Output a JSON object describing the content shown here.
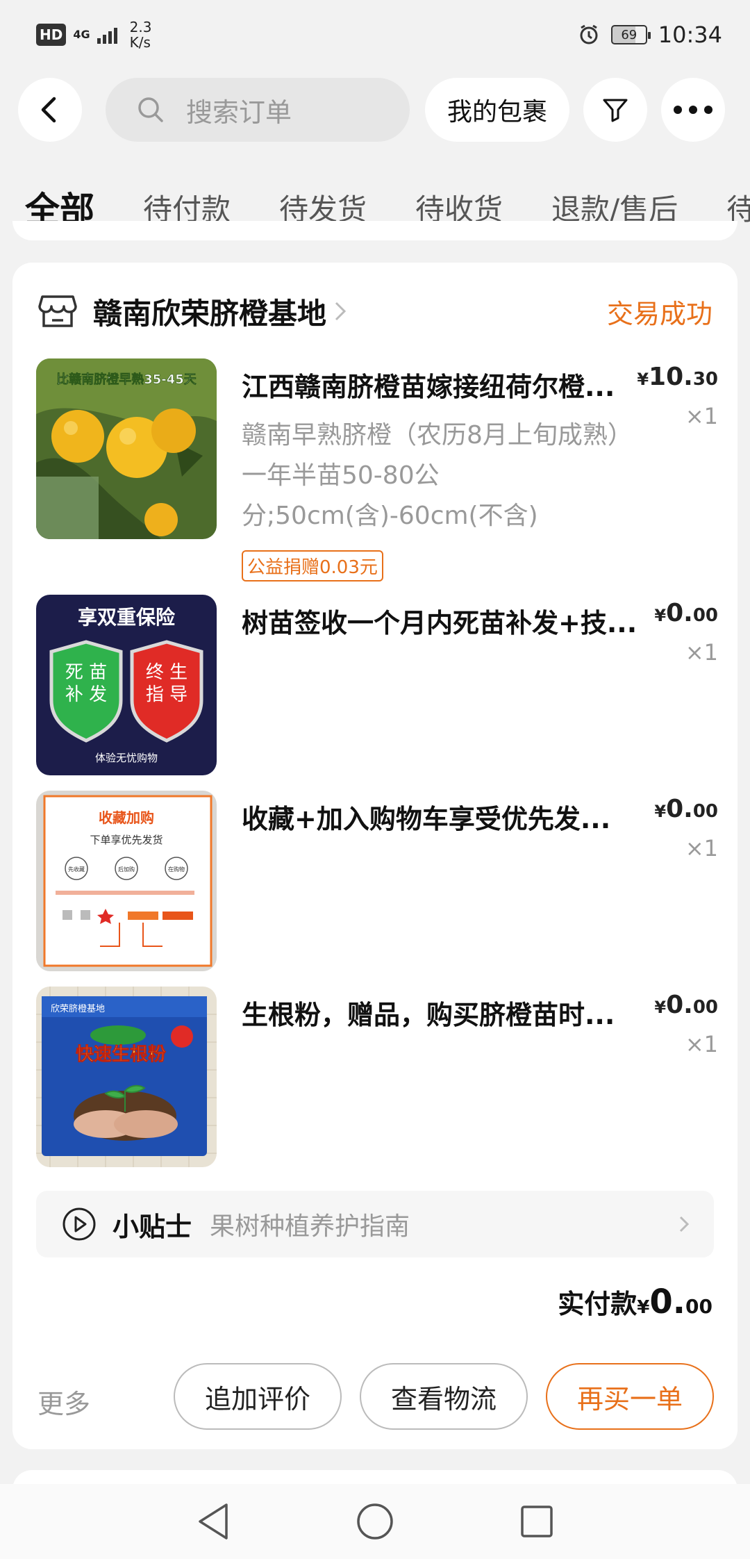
{
  "status_bar": {
    "hd": "HD",
    "network": "4G",
    "speed": "2.3\nK/s",
    "speed_value": "2.3",
    "speed_unit": "K/s",
    "battery": "69",
    "time": "10:34"
  },
  "search": {
    "placeholder": "搜索订单"
  },
  "top_buttons": {
    "my_packages": "我的包裹"
  },
  "tabs": [
    {
      "label": "全部",
      "active": true
    },
    {
      "label": "待付款"
    },
    {
      "label": "待发货"
    },
    {
      "label": "待收货"
    },
    {
      "label": "退款/售后"
    },
    {
      "label": "待"
    }
  ],
  "order": {
    "shop_name": "赣南欣荣脐橙基地",
    "status": "交易成功",
    "items": [
      {
        "title": "江西赣南脐橙苗嫁接纽荷尔橙...",
        "spec": "赣南早熟脐橙（农历8月上旬成熟）一年半苗50-80公分;50cm(含)-60cm(不含)",
        "price_yen": "¥",
        "price_int": "10.",
        "price_dec": "30",
        "qty": "×1",
        "charity": "公益捐赠0.03元",
        "thumb_text": "比赣南脐橙早熟35-45天"
      },
      {
        "title": "树苗签收一个月内死苗补发+技...",
        "price_yen": "¥",
        "price_int": "0.",
        "price_dec": "00",
        "qty": "×1",
        "thumb_title": "享双重保险",
        "thumb_left": "死苗\n补发",
        "thumb_left_1": "死 苗",
        "thumb_left_2": "补 发",
        "thumb_right_1": "终 生",
        "thumb_right_2": "指 导",
        "thumb_foot": "体验无忧购物"
      },
      {
        "title": "收藏+加入购物车享受优先发...",
        "price_yen": "¥",
        "price_int": "0.",
        "price_dec": "00",
        "qty": "×1",
        "thumb_title": "收藏加购",
        "thumb_sub": "下单享优先发货",
        "thumb_c1": "先收藏",
        "thumb_c2": "后加购",
        "thumb_c3": "在购物"
      },
      {
        "title": "生根粉，赠品，购买脐橙苗时...",
        "price_yen": "¥",
        "price_int": "0.",
        "price_dec": "00",
        "qty": "×1",
        "thumb_top": "欣荣脐橙基地",
        "thumb_brand": "快速生根粉"
      }
    ],
    "tips_label": "小贴士",
    "tips_text": "果树种植养护指南",
    "total_label": "实付款",
    "total_yen": "¥",
    "total_int": "0.",
    "total_dec": "00",
    "more": "更多",
    "actions": {
      "review": "追加评价",
      "logistics": "查看物流",
      "rebuy": "再买一单"
    }
  },
  "colors": {
    "accent": "#e8701a",
    "background": "#f2f2f2"
  }
}
